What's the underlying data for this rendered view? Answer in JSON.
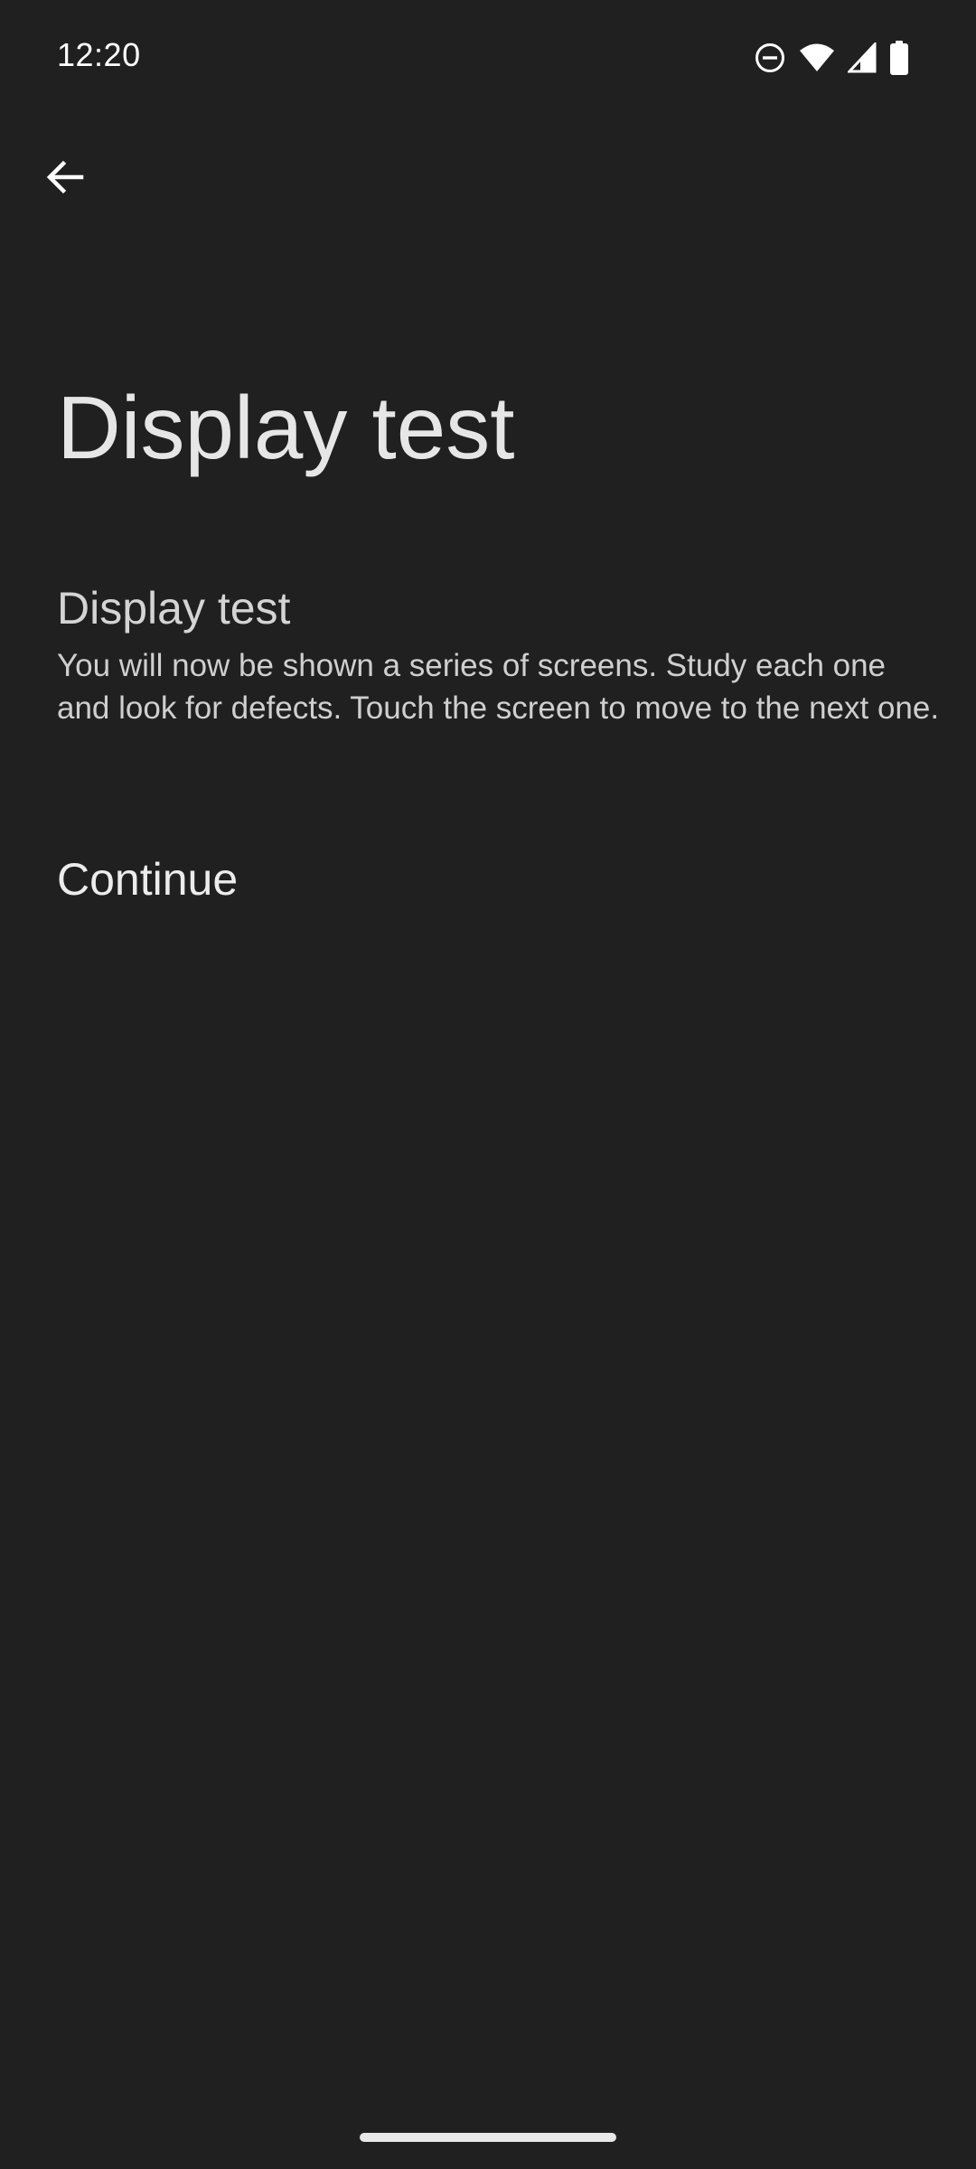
{
  "status_bar": {
    "time": "12:20",
    "icons": [
      "do-not-disturb-icon",
      "wifi-icon",
      "cellular-signal-icon",
      "battery-icon"
    ]
  },
  "app_bar": {
    "back_icon": "arrow-back-icon"
  },
  "page": {
    "title": "Display test",
    "section_heading": "Display test",
    "section_body": "You will now be shown a series of screens. Study each one and look for defects. Touch the screen to move to the next one.",
    "continue_label": "Continue"
  },
  "colors": {
    "background": "#202020",
    "text_primary": "#e6e6e6",
    "text_secondary": "#cfcfcf"
  }
}
